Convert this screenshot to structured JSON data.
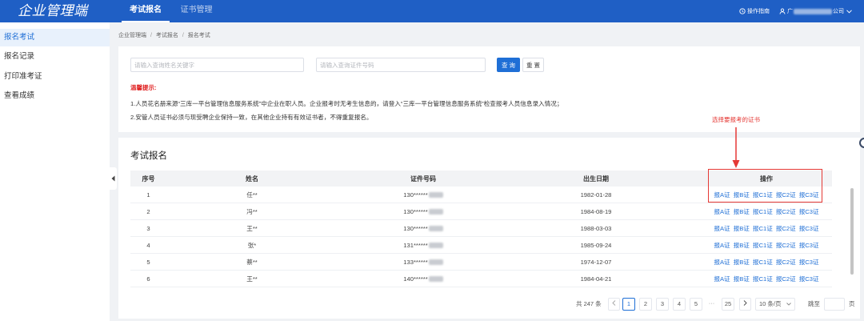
{
  "header": {
    "logo": "企业管理端",
    "tabs": [
      {
        "label": "考试报名",
        "active": true
      },
      {
        "label": "证书管理",
        "active": false
      }
    ],
    "guide": {
      "label": "操作指南",
      "icon": "guide-icon"
    },
    "user": {
      "name_start": "广",
      "name_end": "公司",
      "icon": "user-icon"
    }
  },
  "sidebar": {
    "items": [
      {
        "label": "报名考试",
        "active": true
      },
      {
        "label": "报名记录",
        "active": false
      },
      {
        "label": "打印准考证",
        "active": false
      },
      {
        "label": "查看成绩",
        "active": false
      }
    ]
  },
  "breadcrumb": {
    "items": [
      "企业管理端",
      "考试报名",
      "报名考试"
    ],
    "separator": "/"
  },
  "search": {
    "name_placeholder": "请输入查询姓名关键字",
    "id_placeholder": "请输入查询证件号码",
    "query_label": "查询",
    "reset_label": "重置"
  },
  "notice": {
    "title": "温馨提示:",
    "lines": [
      "1.人员花名册来源“三库一平台管理信息服务系统”中企业在职人员。企业报考时无考生信息的，请登入“三库一平台管理信息服务系统”检查报考人员信息录入情况；",
      "2.安管人员证书必须与现受聘企业保持一致，在其他企业持有有效证书者，不得重复报名。"
    ]
  },
  "annotation": {
    "label": "选择要报考的证书"
  },
  "table": {
    "title": "考试报名",
    "columns": [
      "序号",
      "姓名",
      "证件号码",
      "出生日期",
      "操作"
    ],
    "actions": [
      "报A证",
      "报B证",
      "报C1证",
      "报C2证",
      "报C3证"
    ],
    "rows": [
      {
        "index": "1",
        "name": "任**",
        "id_number": "130******",
        "birth_date": "1982-01-28"
      },
      {
        "index": "2",
        "name": "冯**",
        "id_number": "130******",
        "birth_date": "1984-08-19"
      },
      {
        "index": "3",
        "name": "王**",
        "id_number": "130******",
        "birth_date": "1988-03-03"
      },
      {
        "index": "4",
        "name": "张*",
        "id_number": "131******",
        "birth_date": "1985-09-24"
      },
      {
        "index": "5",
        "name": "蔡**",
        "id_number": "133******",
        "birth_date": "1974-12-07"
      },
      {
        "index": "6",
        "name": "王**",
        "id_number": "140******",
        "birth_date": "1984-04-21"
      }
    ]
  },
  "pagination": {
    "total": "共 247 条",
    "pages": [
      {
        "label": "1",
        "active": true
      },
      {
        "label": "2",
        "active": false
      },
      {
        "label": "3",
        "active": false
      },
      {
        "label": "4",
        "active": false
      },
      {
        "label": "5",
        "active": false
      }
    ],
    "ellipsis": "···",
    "last_page": "25",
    "page_size": "10 条/页",
    "jump_label": "跳至",
    "page_unit": "页"
  },
  "colors": {
    "header_bg": "#1f5fc5",
    "accent": "#1f6fd6",
    "annotation_red": "#e53935",
    "notice_red": "#e02020",
    "page_bg": "#f0f2f5"
  }
}
